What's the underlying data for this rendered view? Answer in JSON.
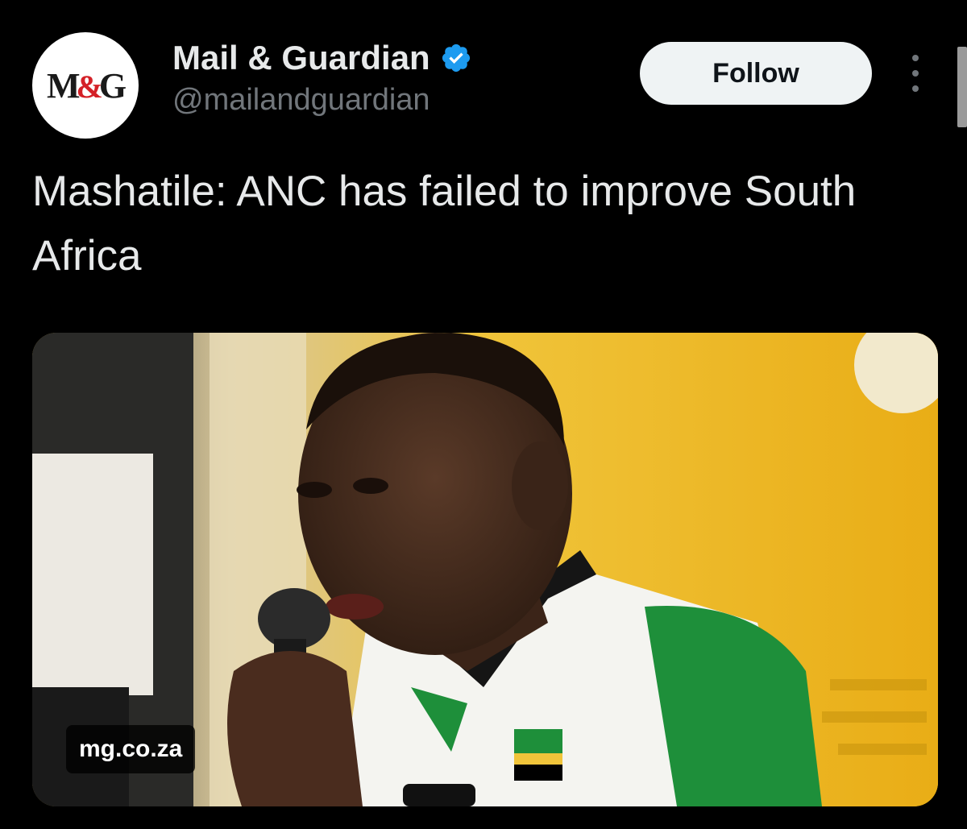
{
  "account": {
    "display_name": "Mail & Guardian",
    "handle": "@mailandguardian",
    "verified": true,
    "avatar": {
      "logo_text_left": "M",
      "logo_text_amp": "&",
      "logo_text_right": "G",
      "logo_accent_color": "#d42027"
    }
  },
  "actions": {
    "follow_label": "Follow",
    "more_icon": "more-vertical-icon"
  },
  "tweet": {
    "text": "Mashatile: ANC has failed to improve South Africa"
  },
  "media": {
    "domain": "mg.co.za"
  },
  "colors": {
    "background": "#000000",
    "primary_text": "#e7e9ea",
    "secondary_text": "#71767b",
    "verified_badge": "#1d9bf0",
    "follow_button_bg": "#eff3f4"
  }
}
